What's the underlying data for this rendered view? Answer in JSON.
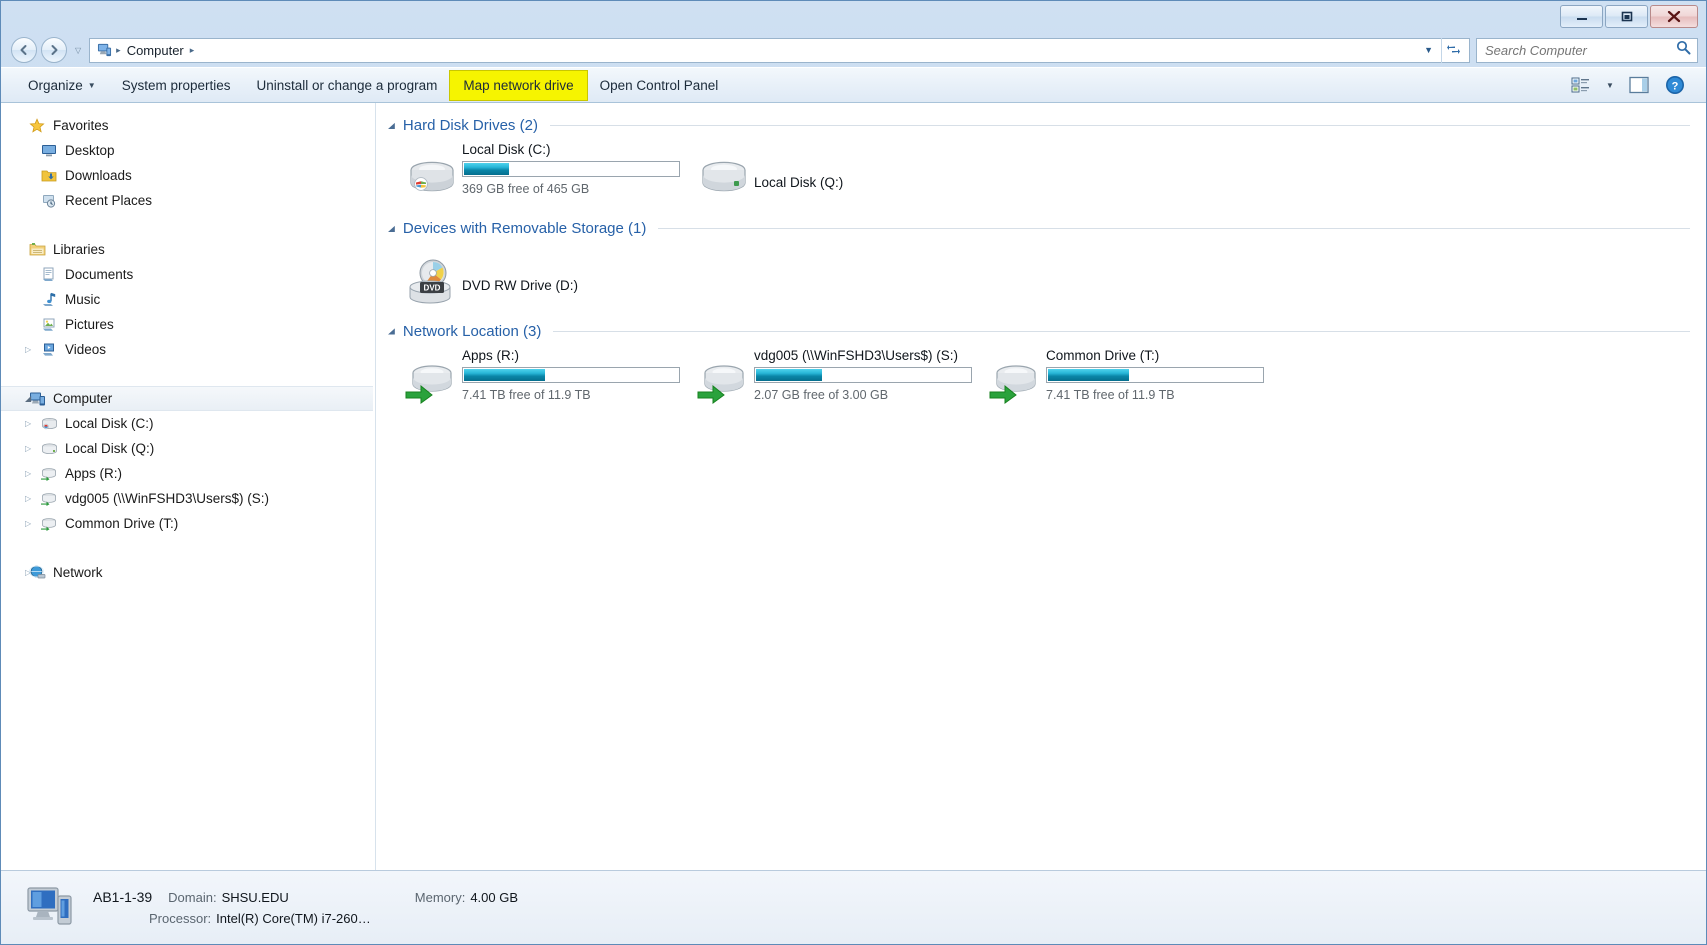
{
  "window": {
    "minimize_label": "Minimize",
    "maximize_label": "Maximize",
    "close_label": "Close"
  },
  "address": {
    "computer_icon": "computer-icon",
    "crumb_root": "Computer",
    "separator": "▸",
    "dropdown": "▼",
    "refresh_icon": "refresh-icon"
  },
  "search": {
    "placeholder": "Search Computer",
    "value": "",
    "icon": "search-icon"
  },
  "toolbar": {
    "organize": "Organize",
    "organize_caret": "▼",
    "system_properties": "System properties",
    "uninstall": "Uninstall or change a program",
    "map_network_drive": "Map network drive",
    "open_control_panel": "Open Control Panel",
    "view_icon": "view-options-icon",
    "view_caret": "▼",
    "preview_pane_icon": "preview-pane-icon",
    "help_icon": "help-icon"
  },
  "sidebar": {
    "sections": [
      {
        "label": "Favorites",
        "icon": "star-icon",
        "items": [
          {
            "label": "Desktop",
            "icon": "desktop-icon"
          },
          {
            "label": "Downloads",
            "icon": "downloads-folder-icon"
          },
          {
            "label": "Recent Places",
            "icon": "recent-places-icon"
          }
        ]
      },
      {
        "label": "Libraries",
        "icon": "libraries-folder-icon",
        "items": [
          {
            "label": "Documents",
            "icon": "documents-library-icon"
          },
          {
            "label": "Music",
            "icon": "music-library-icon"
          },
          {
            "label": "Pictures",
            "icon": "pictures-library-icon"
          },
          {
            "label": "Videos",
            "icon": "videos-library-icon"
          }
        ]
      },
      {
        "label": "Computer",
        "icon": "computer-icon",
        "selected": true,
        "items": [
          {
            "label": "Local Disk (C:)",
            "icon": "system-drive-icon"
          },
          {
            "label": "Local Disk (Q:)",
            "icon": "hard-drive-icon"
          },
          {
            "label": "Apps (R:)",
            "icon": "network-drive-icon"
          },
          {
            "label": "vdg005 (\\\\WinFSHD3\\Users$) (S:)",
            "icon": "network-drive-icon"
          },
          {
            "label": "Common Drive (T:)",
            "icon": "network-drive-icon"
          }
        ]
      },
      {
        "label": "Network",
        "icon": "network-globe-icon",
        "items": []
      }
    ]
  },
  "content": {
    "groups": [
      {
        "title": "Hard Disk Drives (2)",
        "collapse_icon": "◢",
        "items": [
          {
            "name": "Local Disk (C:)",
            "icon": "system-drive-icon",
            "has_bar": true,
            "fill_percent": 21,
            "sub": "369 GB free of 465 GB"
          },
          {
            "name": "Local Disk (Q:)",
            "icon": "hard-drive-icon",
            "has_bar": false,
            "sub": ""
          }
        ]
      },
      {
        "title": "Devices with Removable Storage (1)",
        "collapse_icon": "◢",
        "items": [
          {
            "name": "DVD RW Drive (D:)",
            "icon": "dvd-drive-icon",
            "has_bar": false,
            "sub": ""
          }
        ]
      },
      {
        "title": "Network Location (3)",
        "collapse_icon": "◢",
        "items": [
          {
            "name": "Apps (R:)",
            "icon": "network-drive-icon",
            "has_bar": true,
            "fill_percent": 38,
            "sub": "7.41 TB free of 11.9 TB"
          },
          {
            "name": "vdg005 (\\\\WinFSHD3\\Users$) (S:)",
            "icon": "network-drive-icon",
            "has_bar": true,
            "fill_percent": 31,
            "sub": "2.07 GB free of 3.00 GB"
          },
          {
            "name": "Common Drive (T:)",
            "icon": "network-drive-icon",
            "has_bar": true,
            "fill_percent": 38,
            "sub": "7.41 TB free of 11.9 TB"
          }
        ]
      }
    ]
  },
  "statusbar": {
    "icon": "computer-large-icon",
    "computer_name": "AB1-1-39",
    "domain_label": "Domain:",
    "domain_value": "SHSU.EDU",
    "memory_label": "Memory:",
    "memory_value": "4.00 GB",
    "processor_label": "Processor:",
    "processor_value": "Intel(R) Core(TM) i7-260…"
  },
  "colors": {
    "accent": "#2761a8",
    "highlight": "#f6f400",
    "bar_fill": "#0a86a8"
  }
}
